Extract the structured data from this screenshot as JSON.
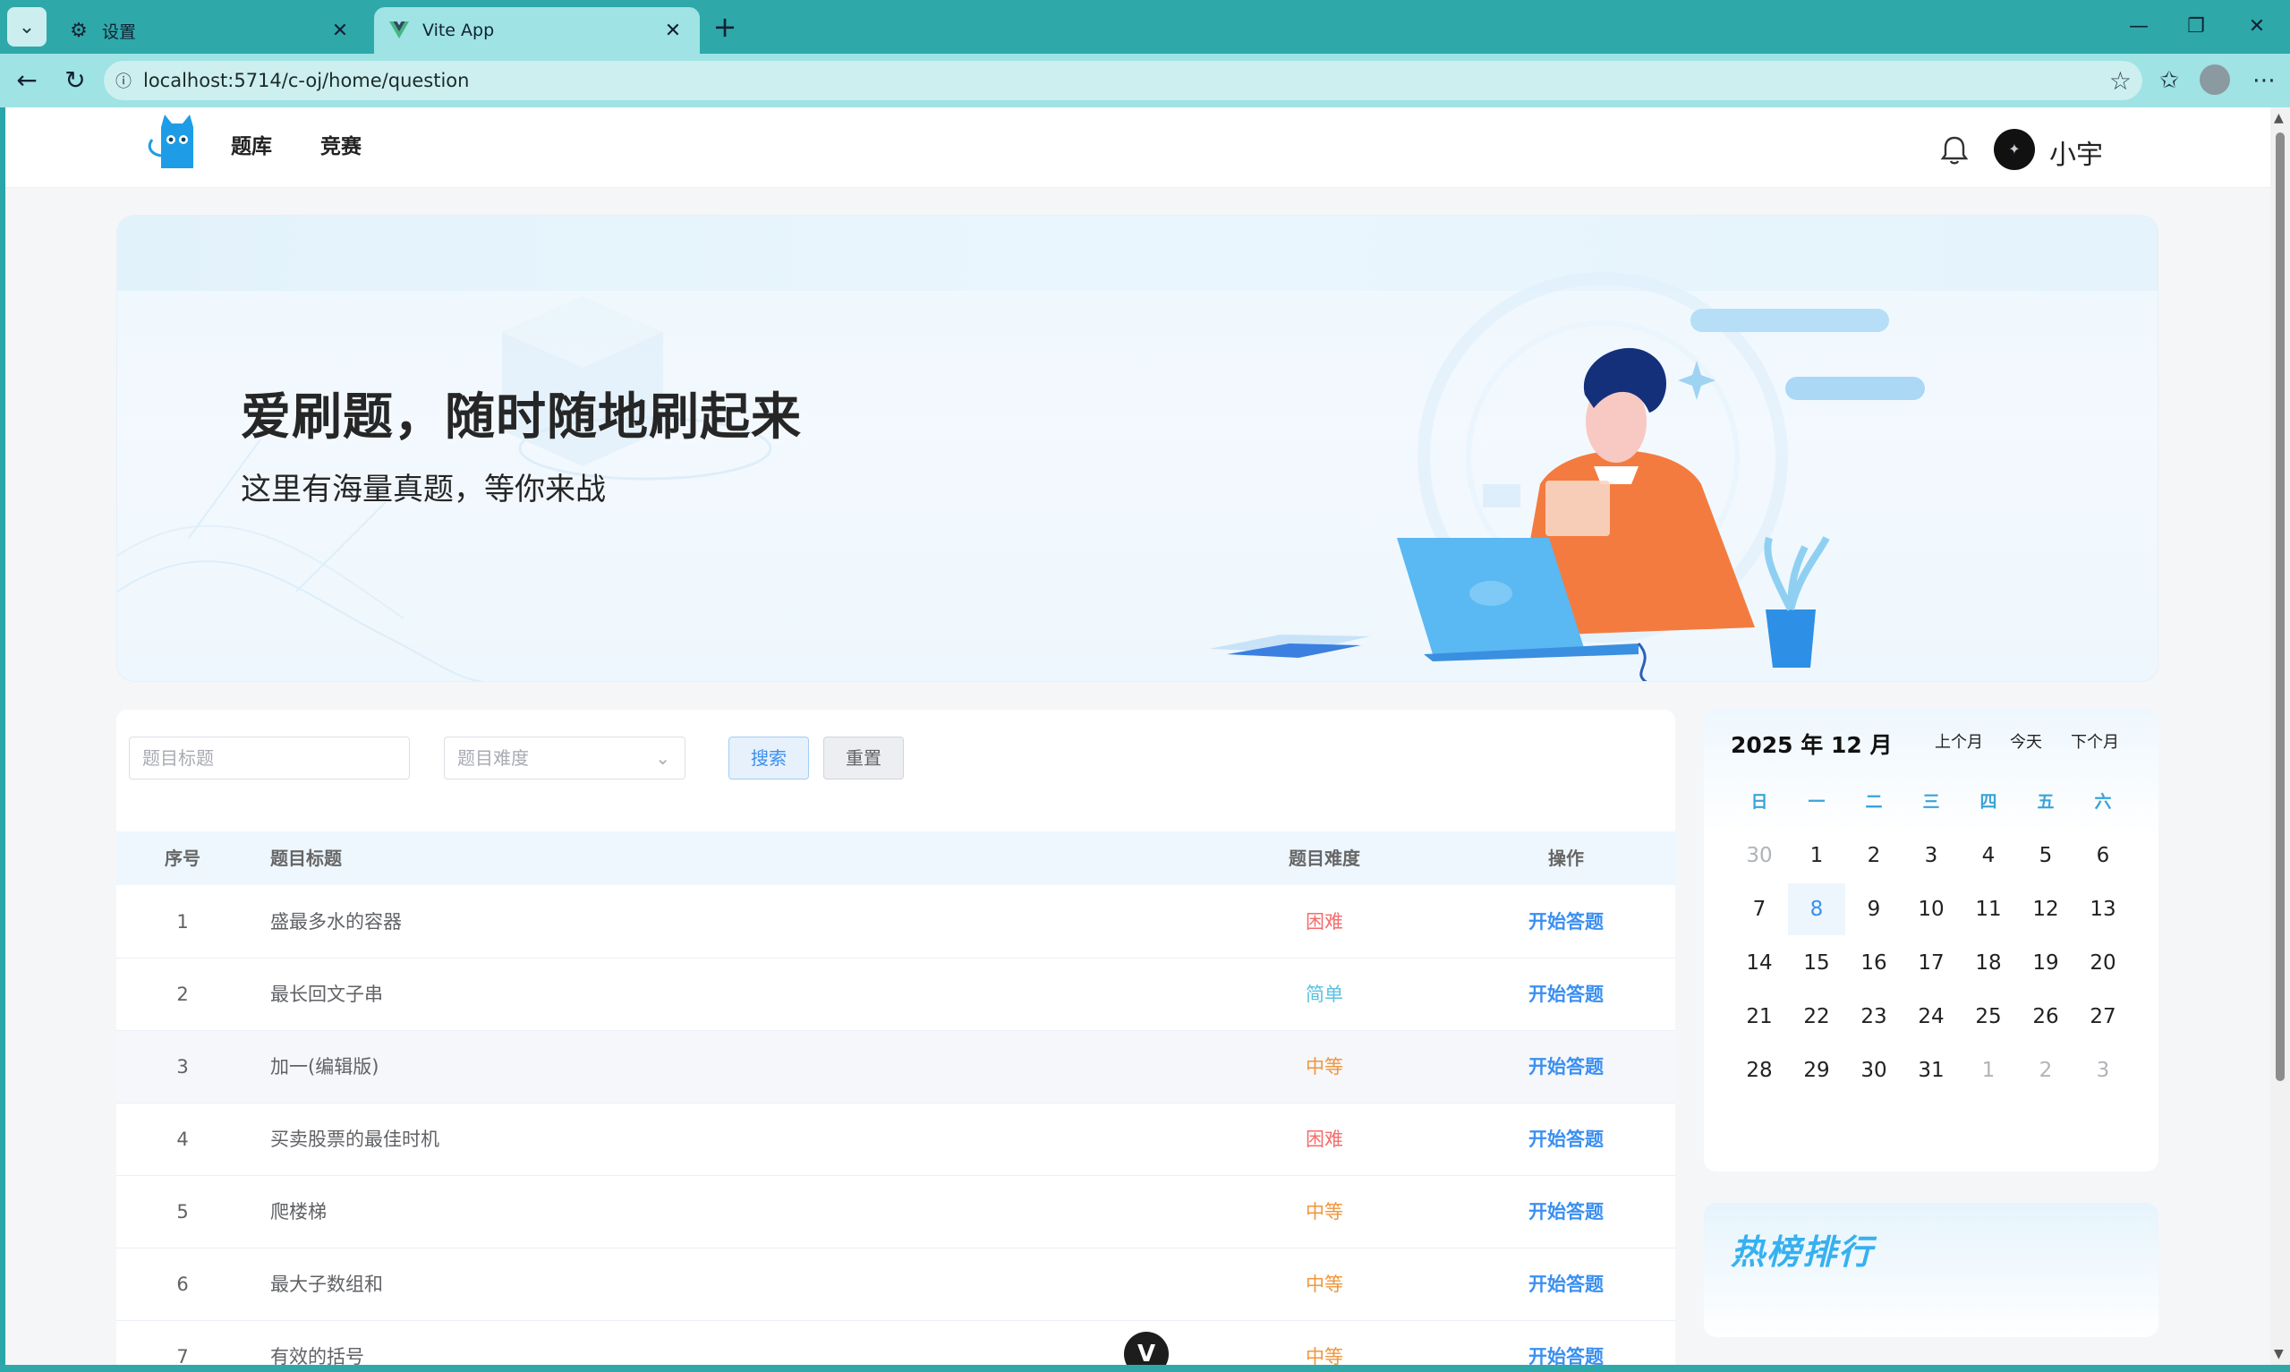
{
  "browser": {
    "tabs": [
      {
        "title": "设置",
        "active": false
      },
      {
        "title": "Vite App",
        "active": true
      }
    ],
    "url": "localhost:5714/c-oj/home/question"
  },
  "nav": {
    "links": [
      "题库",
      "竞赛"
    ],
    "username": "小宇"
  },
  "banner": {
    "title": "爱刷题，随时随地刷起来",
    "subtitle": "这里有海量真题，等你来战"
  },
  "filters": {
    "title_placeholder": "题目标题",
    "difficulty_placeholder": "题目难度",
    "search_label": "搜索",
    "reset_label": "重置"
  },
  "table": {
    "headers": [
      "序号",
      "题目标题",
      "题目难度",
      "操作"
    ],
    "rows": [
      {
        "index": "1",
        "title": "盛最多水的容器",
        "difficulty": "困难",
        "action": "开始答题"
      },
      {
        "index": "2",
        "title": "最长回文子串",
        "difficulty": "简单",
        "action": "开始答题"
      },
      {
        "index": "3",
        "title": "加一(编辑版)",
        "difficulty": "中等",
        "action": "开始答题"
      },
      {
        "index": "4",
        "title": "买卖股票的最佳时机",
        "difficulty": "困难",
        "action": "开始答题"
      },
      {
        "index": "5",
        "title": "爬楼梯",
        "difficulty": "中等",
        "action": "开始答题"
      },
      {
        "index": "6",
        "title": "最大子数组和",
        "difficulty": "中等",
        "action": "开始答题"
      },
      {
        "index": "7",
        "title": "有效的括号",
        "difficulty": "中等",
        "action": "开始答题"
      }
    ],
    "difficulty_colors": {
      "困难": "#f56c6c",
      "简单": "#5bc0de",
      "中等": "#f0963c"
    }
  },
  "calendar": {
    "title": "2025 年 12 月",
    "prev_label": "上个月",
    "today_label": "今天",
    "next_label": "下个月",
    "weekdays": [
      "日",
      "一",
      "二",
      "三",
      "四",
      "五",
      "六"
    ],
    "weeks": [
      [
        "30",
        "1",
        "2",
        "3",
        "4",
        "5",
        "6"
      ],
      [
        "7",
        "8",
        "9",
        "10",
        "11",
        "12",
        "13"
      ],
      [
        "14",
        "15",
        "16",
        "17",
        "18",
        "19",
        "20"
      ],
      [
        "21",
        "22",
        "23",
        "24",
        "25",
        "26",
        "27"
      ],
      [
        "28",
        "29",
        "30",
        "31",
        "1",
        "2",
        "3"
      ]
    ],
    "today": "8"
  },
  "hot": {
    "title": "热榜排行"
  }
}
